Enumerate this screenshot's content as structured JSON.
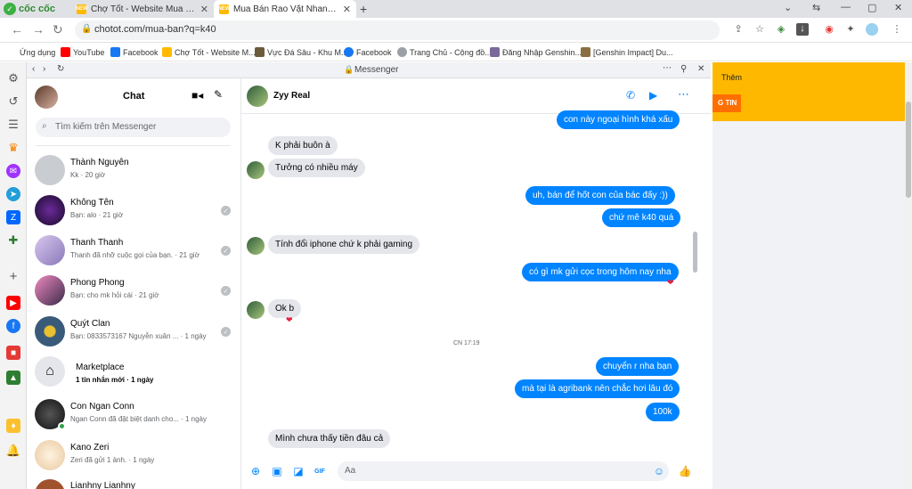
{
  "browser": {
    "brand": "cốc cốc",
    "tabs": [
      {
        "title": "Chợ Tốt - Website Mua Bán, R",
        "fav": "NEW",
        "active": false
      },
      {
        "title": "Mua Bán Rao Vặt Nhanh Chó",
        "fav": "NEW",
        "active": true
      }
    ],
    "url": "chotot.com/mua-ban?q=k40",
    "bookmarks": [
      {
        "label": "Ứng dụng",
        "color": "#5f6368"
      },
      {
        "label": "YouTube",
        "color": "#ff0000"
      },
      {
        "label": "Facebook",
        "color": "#1877f2"
      },
      {
        "label": "Chợ Tốt - Website M...",
        "color": "#ffba00"
      },
      {
        "label": "Vực Đá Sâu - Khu M...",
        "color": "#6b5b3a"
      },
      {
        "label": "Facebook",
        "color": "#1877f2"
      },
      {
        "label": "Trang Chủ - Cộng đồ...",
        "color": "#9aa0a6"
      },
      {
        "label": "Đăng Nhập Genshin...",
        "color": "#7a6a9a"
      },
      {
        "label": "[Genshin Impact] Du...",
        "color": "#8a7040"
      }
    ]
  },
  "messenger": {
    "popup_title": "Messenger",
    "sidebar_title": "Chat",
    "search_placeholder": "Tìm kiếm trên Messenger",
    "conversations": [
      {
        "name": "Thành Nguyên",
        "preview": "Kk · 20 giờ",
        "avatar": "#c9ccd1"
      },
      {
        "name": "Không Tên",
        "preview": "Bạn: alo · 21 giờ",
        "avatar": "#3a1a5a"
      },
      {
        "name": "Thanh Thanh",
        "preview": "Thanh đã nhỡ cuộc gọi của bạn. · 21 giờ",
        "avatar": "#b8a8d8"
      },
      {
        "name": "Phong Phong",
        "preview": "Bạn: cho mk hỏi cái · 21 giờ",
        "avatar": "#d85a9a"
      },
      {
        "name": "Quýt Clan",
        "preview": "Bạn: 0833573167 Nguyễn xuân ... · 1 ngày",
        "avatar": "#4a6a8a"
      },
      {
        "name": "Marketplace",
        "preview": "1 tin nhắn mới · 1 ngày",
        "avatar": "#e4e6eb"
      },
      {
        "name": "Con Ngan Conn",
        "preview": "Ngan Conn đã đặt biệt danh cho... · 1 ngày",
        "avatar": "#2a2a2a"
      },
      {
        "name": "Kano Zeri",
        "preview": "Zeri đã gửi 1 ảnh. · 1 ngày",
        "avatar": "#f5e6d0"
      },
      {
        "name": "Lianhny Lianhny",
        "preview": "",
        "avatar": "#a0522d"
      }
    ],
    "chat_name": "Zyy Real",
    "messages": [
      {
        "dir": "out",
        "text": "con này ngoại hình khá xấu"
      },
      {
        "dir": "in",
        "text": "K phải buôn à"
      },
      {
        "dir": "in",
        "text": "Tưởng có nhiều máy"
      },
      {
        "dir": "out",
        "text": "uh, bán để hốt con của bác đấy :))"
      },
      {
        "dir": "out",
        "text": "chứ mê k40 quá"
      },
      {
        "dir": "in",
        "text": "Tính đổi iphone chứ k phải gaming"
      },
      {
        "dir": "out",
        "text": "có gì mk gửi cọc trong hôm nay nha"
      },
      {
        "dir": "in",
        "text": "Ok b"
      },
      {
        "dir": "out",
        "text": "chuyển r nha bạn"
      },
      {
        "dir": "out",
        "text": "mà tại là agribank nên chắc hơi lâu đó"
      },
      {
        "dir": "out",
        "text": "100k"
      },
      {
        "dir": "in",
        "text": "Mình chưa thấy tiền đâu cả"
      }
    ],
    "timestamp": "CN 17:19",
    "input_placeholder": "Aa"
  },
  "page": {
    "more_label": "Thêm",
    "post_button": "G TIN"
  }
}
